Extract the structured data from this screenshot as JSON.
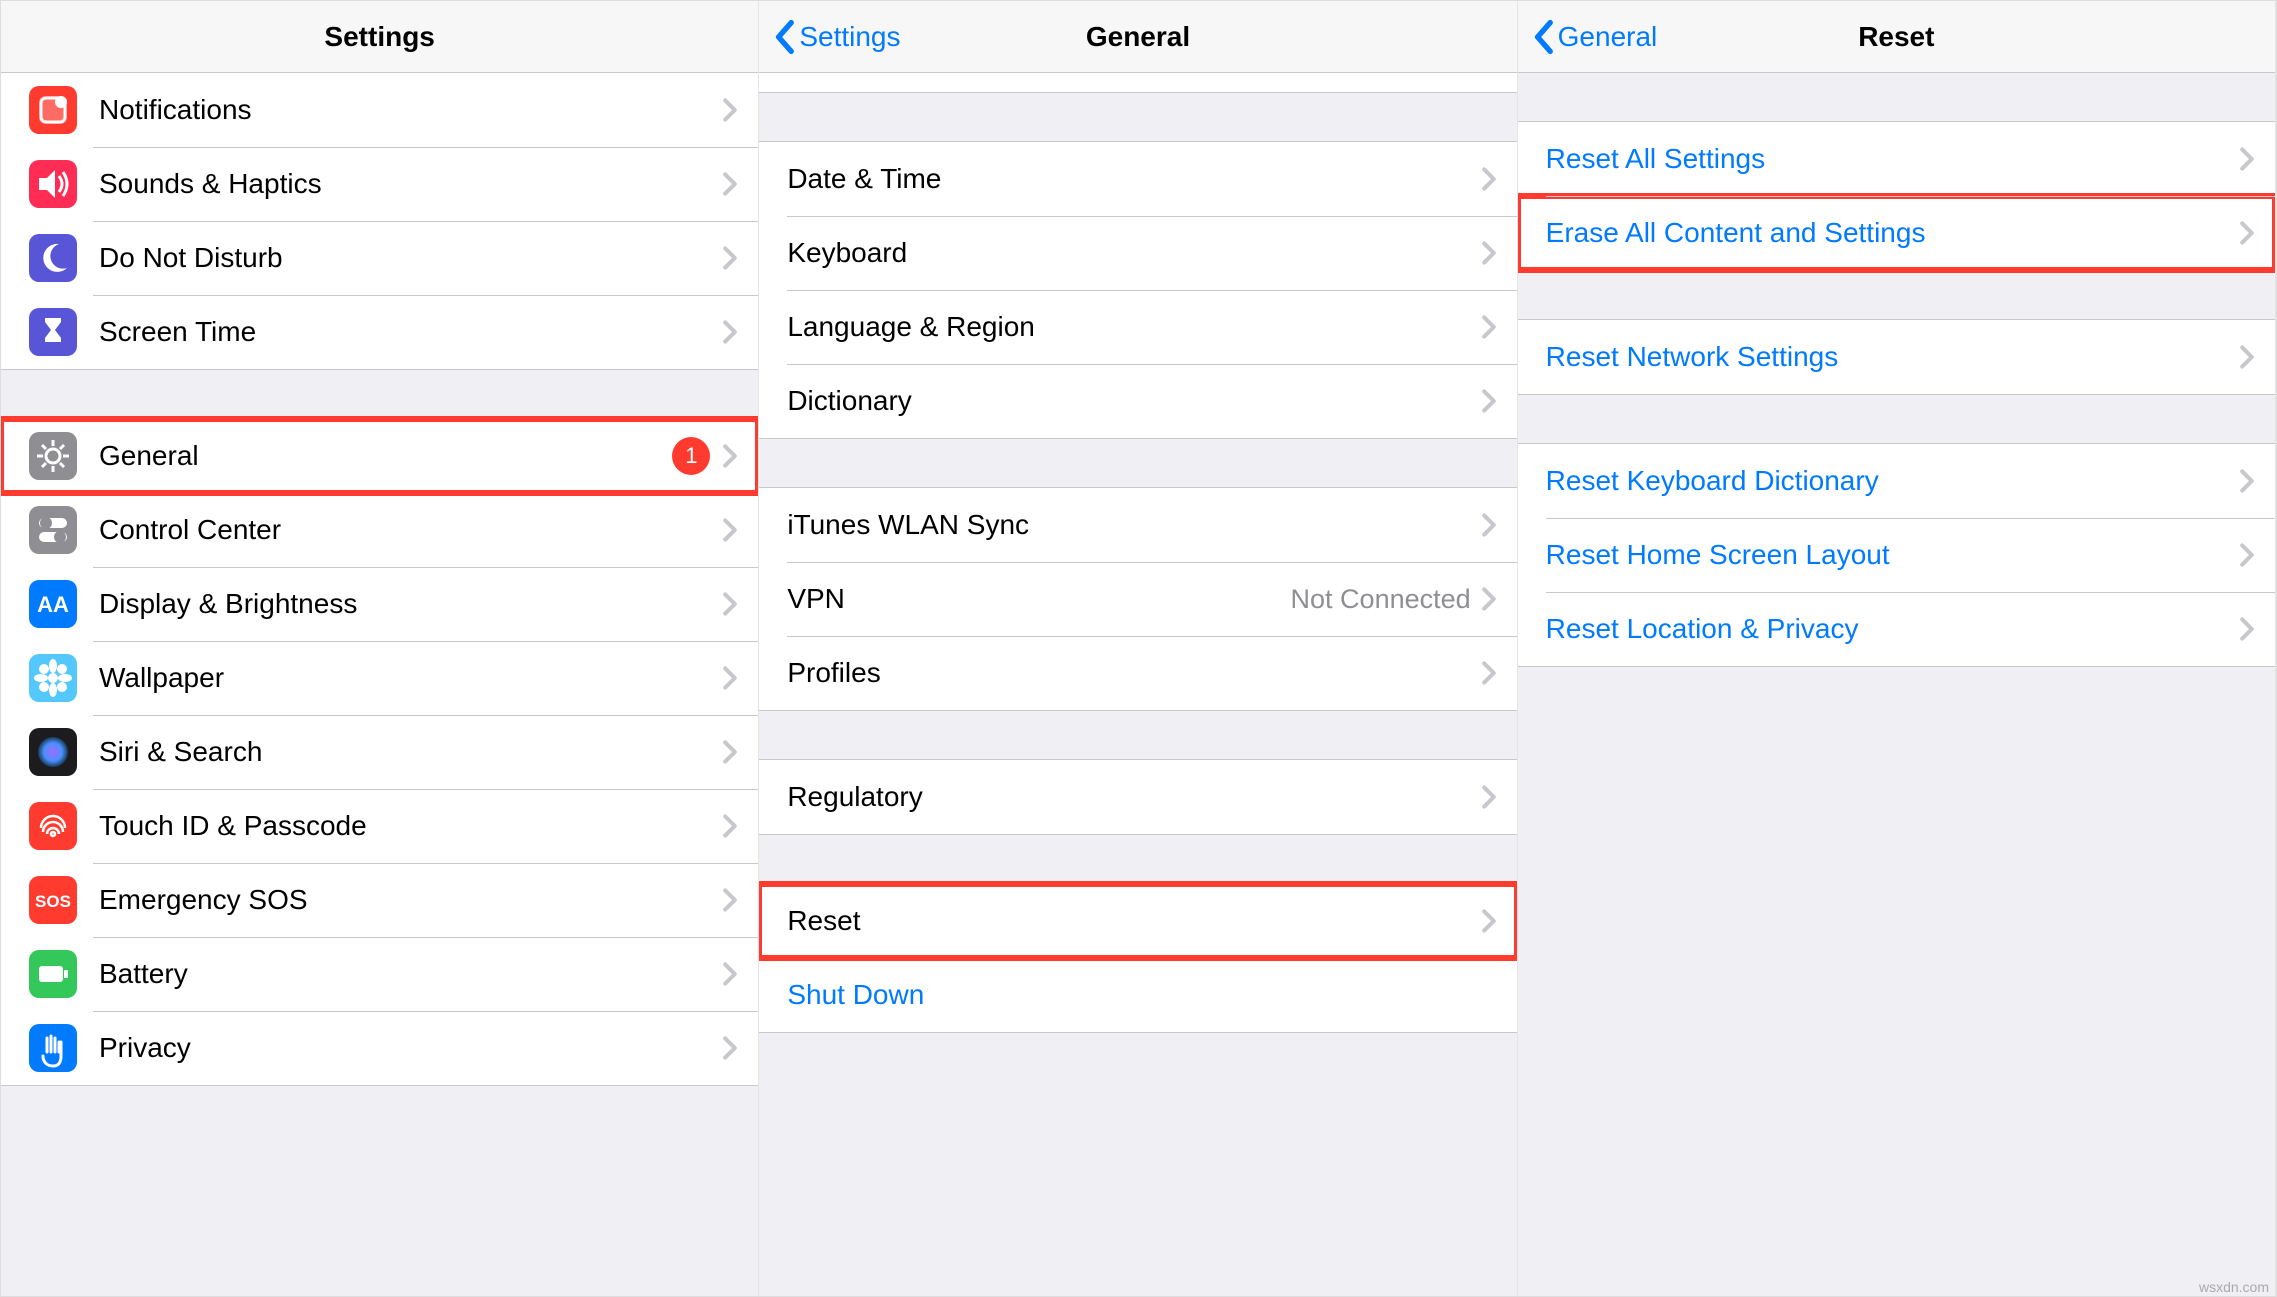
{
  "panel1": {
    "title": "Settings",
    "group1": [
      {
        "label": "Notifications",
        "iconColor": "#ff3b30",
        "icon": "notifications"
      },
      {
        "label": "Sounds & Haptics",
        "iconColor": "#ff2d55",
        "icon": "sounds"
      },
      {
        "label": "Do Not Disturb",
        "iconColor": "#5856d6",
        "icon": "moon"
      },
      {
        "label": "Screen Time",
        "iconColor": "#5856d6",
        "icon": "hourglass"
      }
    ],
    "group2": [
      {
        "label": "General",
        "iconColor": "#8e8e93",
        "icon": "gear",
        "badge": "1",
        "highlight": true
      },
      {
        "label": "Control Center",
        "iconColor": "#8e8e93",
        "icon": "switches"
      },
      {
        "label": "Display & Brightness",
        "iconColor": "#007aff",
        "icon": "aa"
      },
      {
        "label": "Wallpaper",
        "iconColor": "#54c7fc",
        "icon": "flower"
      },
      {
        "label": "Siri & Search",
        "iconColor": "#1c1c1e",
        "icon": "siri"
      },
      {
        "label": "Touch ID & Passcode",
        "iconColor": "#ff3b30",
        "icon": "fingerprint"
      },
      {
        "label": "Emergency SOS",
        "iconColor": "#ff3b30",
        "icon": "sos"
      },
      {
        "label": "Battery",
        "iconColor": "#34c759",
        "icon": "battery"
      },
      {
        "label": "Privacy",
        "iconColor": "#007aff",
        "icon": "hand"
      }
    ]
  },
  "panel2": {
    "back": "Settings",
    "title": "General",
    "groups": [
      [
        {
          "label": "Date & Time"
        },
        {
          "label": "Keyboard"
        },
        {
          "label": "Language & Region"
        },
        {
          "label": "Dictionary"
        }
      ],
      [
        {
          "label": "iTunes WLAN Sync"
        },
        {
          "label": "VPN",
          "detail": "Not Connected"
        },
        {
          "label": "Profiles"
        }
      ],
      [
        {
          "label": "Regulatory"
        }
      ],
      [
        {
          "label": "Reset",
          "highlight": true
        },
        {
          "label": "Shut Down",
          "link": true,
          "noChevron": true
        }
      ]
    ]
  },
  "panel3": {
    "back": "General",
    "title": "Reset",
    "groups": [
      [
        {
          "label": "Reset All Settings",
          "link": true
        },
        {
          "label": "Erase All Content and Settings",
          "link": true,
          "highlight": true
        }
      ],
      [
        {
          "label": "Reset Network Settings",
          "link": true
        }
      ],
      [
        {
          "label": "Reset Keyboard Dictionary",
          "link": true
        },
        {
          "label": "Reset Home Screen Layout",
          "link": true
        },
        {
          "label": "Reset Location & Privacy",
          "link": true
        }
      ]
    ]
  },
  "watermark": "wsxdn.com"
}
